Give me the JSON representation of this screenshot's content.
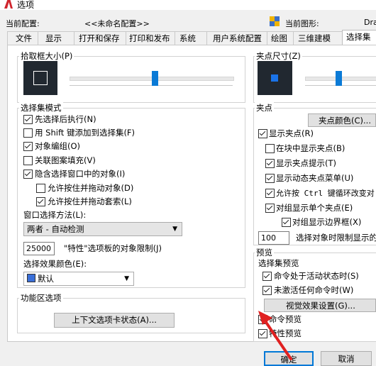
{
  "window": {
    "title": "选项"
  },
  "info": {
    "current_profile_label": "当前配置:",
    "current_profile_value": "<<未命名配置>>",
    "current_drawing_label": "当前图形:",
    "current_drawing_value": "Dra"
  },
  "tabs": [
    "文件",
    "显示",
    "打开和保存",
    "打印和发布",
    "系统",
    "用户系统配置",
    "绘图",
    "三维建模",
    "选择集"
  ],
  "active_tab": "选择集",
  "left": {
    "pickbox_title": "拾取框大小(P)",
    "pickbox_level": 0.52,
    "modes_title": "选择集模式",
    "modes": [
      {
        "label": "先选择后执行(N)",
        "checked": true
      },
      {
        "label": "用 Shift 键添加到选择集(F)",
        "checked": false
      },
      {
        "label": "对象编组(O)",
        "checked": true
      },
      {
        "label": "关联图案填充(V)",
        "checked": false
      },
      {
        "label": "隐含选择窗口中的对象(I)",
        "checked": true
      }
    ],
    "sub_modes": [
      {
        "label": "允许按住并拖动对象(D)",
        "checked": false
      },
      {
        "label": "允许按住并拖动套索(L)",
        "checked": true
      }
    ],
    "window_method_label": "窗口选择方法(L):",
    "window_method_value": "两者 - 自动检测",
    "limit_value": "25000",
    "limit_label": "\"特性\"选项板的对象限制(J)",
    "effect_color_label": "选择效果颜色(E):",
    "effect_color_value": "默认",
    "effect_color_swatch": "#3a6fd8",
    "ribbon_title": "功能区选项",
    "context_tab_button": "上下文选项卡状态(A)..."
  },
  "right": {
    "grip_size_title": "夹点尺寸(Z)",
    "grip_size_level": 0.47,
    "grips_title": "夹点",
    "grip_color_button": "夹点颜色(C)...",
    "grip_options": [
      {
        "label": "显示夹点(R)",
        "checked": true,
        "indent": 0
      },
      {
        "label": "在块中显示夹点(B)",
        "checked": false,
        "indent": 1
      },
      {
        "label": "显示夹点提示(T)",
        "checked": true,
        "indent": 1
      },
      {
        "label": "显示动态夹点菜单(U)",
        "checked": true,
        "indent": 1
      },
      {
        "label": "允许按 Ctrl 键循环改变对",
        "checked": true,
        "indent": 1
      },
      {
        "label": "对组显示单个夹点(E)",
        "checked": true,
        "indent": 1
      },
      {
        "label": "对组显示边界框(X)",
        "checked": true,
        "indent": 2
      }
    ],
    "grip_limit_value": "100",
    "grip_limit_label": "选择对象时限制显示的",
    "preview_title": "预览",
    "selection_preview_title": "选择集预览",
    "preview_options": [
      {
        "label": "命令处于活动状态时(S)",
        "checked": true
      },
      {
        "label": "未激活任何命令时(W)",
        "checked": true
      }
    ],
    "visual_effects_button": "视觉效果设置(G)...",
    "command_preview": {
      "label": "命令预览",
      "checked": true
    },
    "property_preview": {
      "label": "特性预览",
      "checked": true
    }
  },
  "footer": {
    "ok": "确定",
    "cancel": "取消"
  },
  "colors": {
    "accent": "#0a7ad6",
    "ok_border": "#0078d7",
    "annotation_arrow": "#e02020"
  }
}
